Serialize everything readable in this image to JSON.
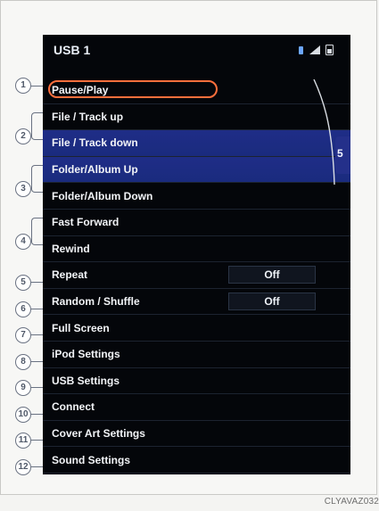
{
  "screen": {
    "title": "USB 1",
    "items": [
      {
        "label": "Pause/Play"
      },
      {
        "label": "File / Track up"
      },
      {
        "label": "File / Track down"
      },
      {
        "label": "Folder/Album Up"
      },
      {
        "label": "Folder/Album Down"
      },
      {
        "label": "Fast Forward"
      },
      {
        "label": "Rewind"
      },
      {
        "label": "Repeat",
        "value": "Off"
      },
      {
        "label": "Random / Shuffle",
        "value": "Off"
      },
      {
        "label": "Full Screen"
      },
      {
        "label": "iPod Settings"
      },
      {
        "label": "USB Settings"
      },
      {
        "label": "Connect"
      },
      {
        "label": "Cover Art Settings"
      },
      {
        "label": "Sound Settings"
      }
    ],
    "scroll_tab_glyph": "5",
    "icons": [
      "bluetooth-icon",
      "signal-icon",
      "battery-icon"
    ]
  },
  "callouts": [
    "1",
    "2",
    "3",
    "4",
    "5",
    "6",
    "7",
    "8",
    "9",
    "10",
    "11",
    "12"
  ],
  "footer_code": "CLYAVAZ032",
  "colors": {
    "screen_background": "#04060a",
    "selection_outline": "#ff6f3c",
    "highlight_row": "#1f2d87",
    "bluetooth_icon": "#6ca6ff"
  }
}
